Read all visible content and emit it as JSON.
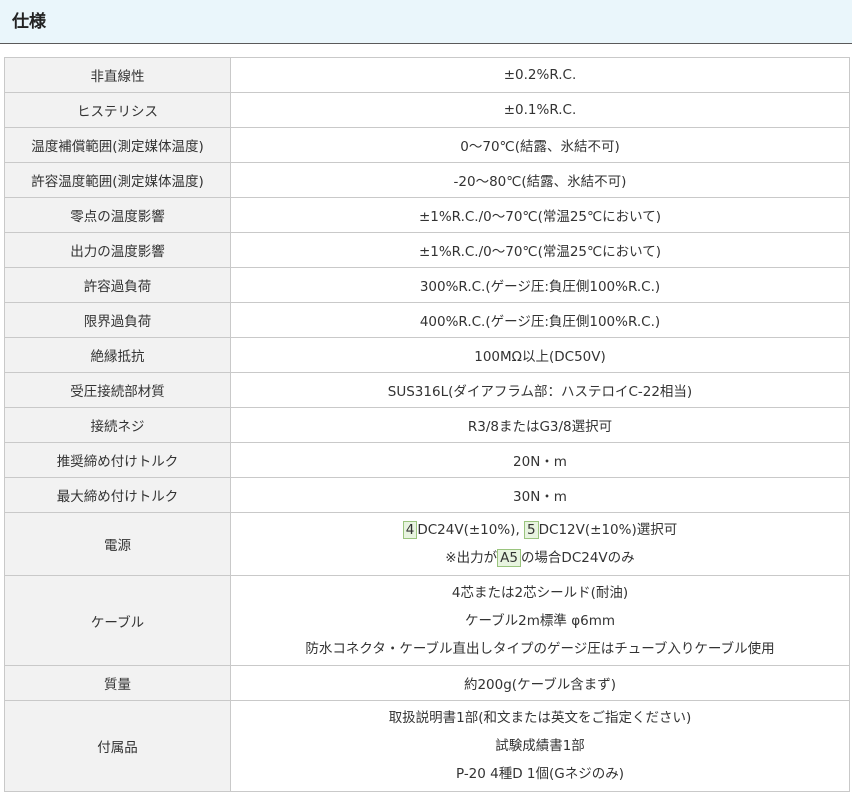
{
  "section": {
    "title": "仕様"
  },
  "rows": [
    {
      "label": "非直線性",
      "value": "±0.2%R.C."
    },
    {
      "label": "ヒステリシス",
      "value": "±0.1%R.C."
    },
    {
      "label": "温度補償範囲(測定媒体温度)",
      "value": "0～70℃(結露、氷結不可)"
    },
    {
      "label": "許容温度範囲(測定媒体温度)",
      "value": "-20～80℃(結露、氷結不可)"
    },
    {
      "label": "零点の温度影響",
      "value": "±1%R.C./0～70℃(常温25℃において)"
    },
    {
      "label": "出力の温度影響",
      "value": "±1%R.C./0～70℃(常温25℃において)"
    },
    {
      "label": "許容過負荷",
      "value": "300%R.C.(ゲージ圧:負圧側100%R.C.)"
    },
    {
      "label": "限界過負荷",
      "value": "400%R.C.(ゲージ圧:負圧側100%R.C.)"
    },
    {
      "label": "絶縁抵抗",
      "value": "100MΩ以上(DC50V)"
    },
    {
      "label": "受圧接続部材質",
      "value": "SUS316L(ダイアフラム部：ハステロイC-22相当)"
    },
    {
      "label": "接続ネジ",
      "value": "R3/8またはG3/8選択可"
    },
    {
      "label": "推奨締め付けトルク",
      "value": "20N・m"
    },
    {
      "label": "最大締め付けトルク",
      "value": "30N・m"
    }
  ],
  "power": {
    "label": "電源",
    "code1": "4",
    "text1": "DC24V(±10%),",
    "code2": "5",
    "text2": "DC12V(±10%)選択可",
    "note_prefix": "※出力が",
    "note_code": "A5",
    "note_suffix": "の場合DC24Vのみ"
  },
  "cable": {
    "label": "ケーブル",
    "lines": [
      "4芯または2芯シールド(耐油)",
      "ケーブル2m標準 φ6mm",
      "防水コネクタ・ケーブル直出しタイプのゲージ圧はチューブ入りケーブル使用"
    ]
  },
  "mass": {
    "label": "質量",
    "value": "約200g(ケーブル含まず)"
  },
  "accessories": {
    "label": "付属品",
    "lines": [
      "取扱説明書1部(和文または英文をご指定ください)",
      "試験成績書1部",
      "P-20 4種D 1個(Gネジのみ)"
    ]
  }
}
